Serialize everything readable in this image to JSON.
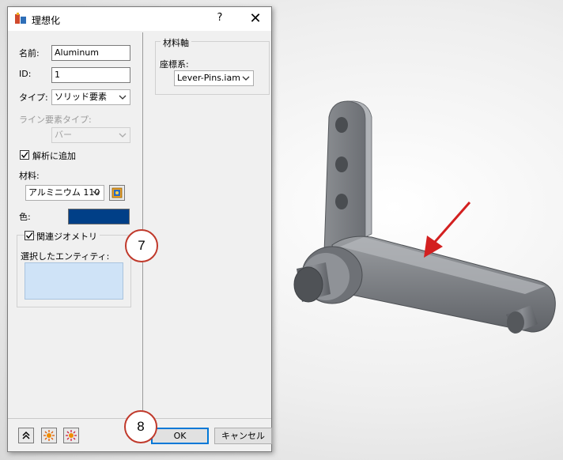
{
  "window": {
    "title": "理想化",
    "help": "?",
    "close": "✕"
  },
  "form": {
    "name_label": "名前:",
    "name_value": "Aluminum",
    "id_label": "ID:",
    "id_value": "1",
    "type_label": "タイプ:",
    "type_value": "ソリッド要素",
    "line_type_label": "ライン要素タイプ:",
    "line_type_value": "バー",
    "add_to_analysis_label": "解析に追加",
    "add_to_analysis_checked": true,
    "material_label": "材料:",
    "material_value": "アルミニウム 110",
    "color_label": "色:",
    "color_value": "#003f87",
    "related_geometry_label": "関連ジオメトリ",
    "related_geometry_checked": true,
    "selected_entities_label": "選択したエンティティ:"
  },
  "material_axis": {
    "group_label": "材料軸",
    "coord_label": "座標系:",
    "coord_value": "Lever-Pins.iam"
  },
  "buttons": {
    "ok": "OK",
    "cancel": "キャンセル"
  },
  "callouts": {
    "seven": "7",
    "eight": "8"
  },
  "colors": {
    "arrow": "#d32020",
    "callout_border": "#c0392b",
    "selection": "#cfe3f7"
  }
}
